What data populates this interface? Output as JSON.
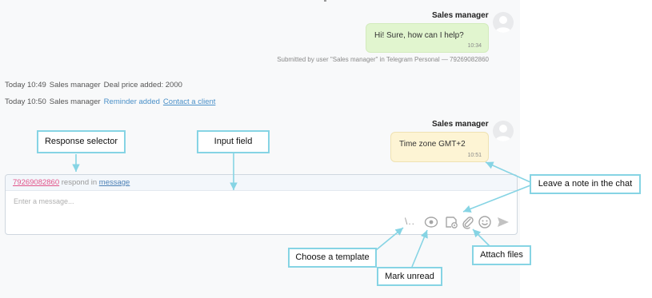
{
  "chat": {
    "messages": [
      {
        "sender": "Sales manager",
        "text": "Hi! Sure, how can I help?",
        "time": "10:34",
        "footer": "Submitted by user \"Sales manager\" in Telegram Personal — 79269082860"
      },
      {
        "sender": "Sales manager",
        "text": "Time zone GMT+2",
        "time": "10:51"
      }
    ],
    "events": [
      {
        "date": "Today 10:49",
        "user": "Sales manager",
        "text": "Deal price added: 2000"
      },
      {
        "date": "Today 10:50",
        "user": "Sales manager",
        "text": "Reminder added",
        "link": "Contact a client"
      }
    ]
  },
  "input": {
    "phone": "79269082860",
    "respond_in": "respond in",
    "channel": "message",
    "placeholder": "Enter a message...",
    "template_glyph": "\\..",
    "icons": [
      "template-icon",
      "eye-icon",
      "note-icon",
      "paperclip-icon",
      "smile-icon",
      "send-icon"
    ]
  },
  "annotations": {
    "response_selector": "Response selector",
    "input_field": "Input field",
    "leave_note": "Leave a note in the chat",
    "choose_template": "Choose a template",
    "mark_unread": "Mark unread",
    "attach_files": "Attach files",
    "callout_border_color": "#86d4e4"
  }
}
